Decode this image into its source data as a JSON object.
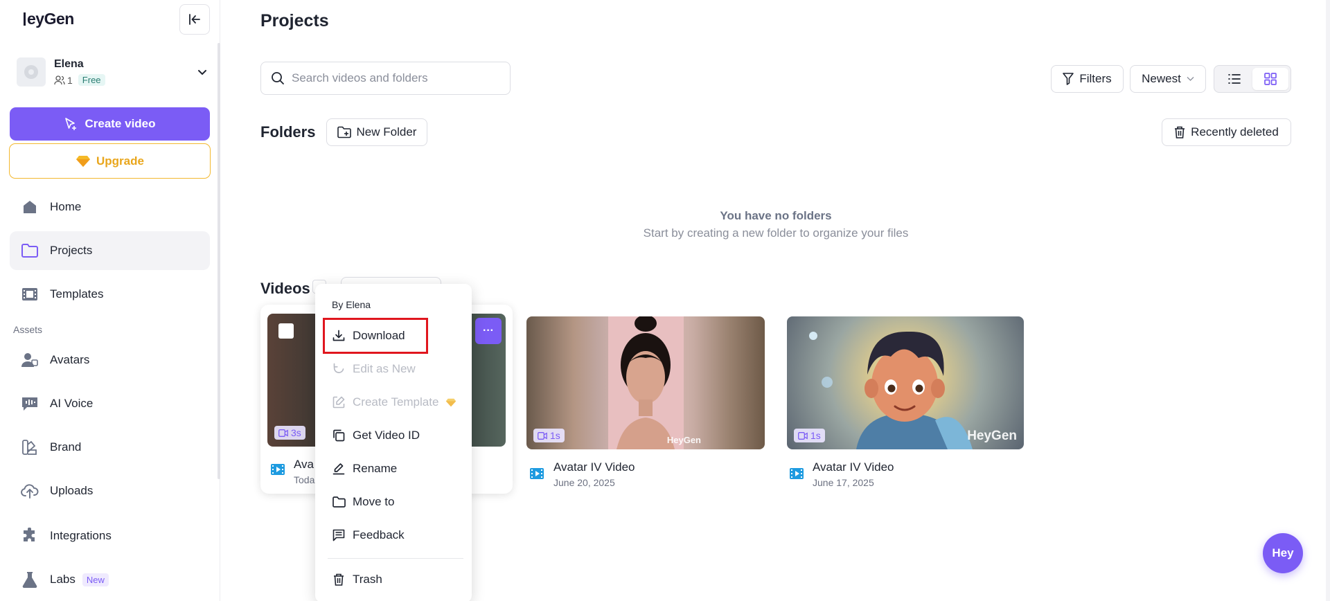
{
  "app": {
    "logo_text": "HeyGen",
    "logo_suffix": "eyGen"
  },
  "sidebar": {
    "user": {
      "name": "Elena",
      "member_count": "1",
      "plan": "Free"
    },
    "create_label": "Create video",
    "upgrade_label": "Upgrade",
    "items": [
      {
        "label": "Home"
      },
      {
        "label": "Projects"
      },
      {
        "label": "Templates"
      },
      {
        "label": "Avatars"
      },
      {
        "label": "AI Voice"
      },
      {
        "label": "Brand"
      },
      {
        "label": "Uploads"
      },
      {
        "label": "Integrations"
      },
      {
        "label": "Labs",
        "badge": "New"
      }
    ],
    "section_assets": "Assets"
  },
  "main": {
    "title": "Projects",
    "search": {
      "placeholder": "Search videos and folders",
      "value": ""
    },
    "filters_label": "Filters",
    "sort_label": "Newest",
    "folders": {
      "title": "Folders",
      "new_folder_label": "New Folder",
      "recently_deleted_label": "Recently deleted",
      "empty_title": "You have no folders",
      "empty_subtitle": "Start by creating a new folder to organize your files"
    },
    "videos": {
      "title": "Videos",
      "items": [
        {
          "title": "Ava",
          "date": "Toda",
          "duration": "3s"
        },
        {
          "title": "Avatar IV Video",
          "date": "June 20, 2025",
          "duration": "1s"
        },
        {
          "title": "Avatar IV Video",
          "date": "June 17, 2025",
          "duration": "1s"
        }
      ]
    }
  },
  "context_menu": {
    "header": "By Elena",
    "items": [
      {
        "label": "Download",
        "enabled": true
      },
      {
        "label": "Edit as New",
        "enabled": false
      },
      {
        "label": "Create Template",
        "enabled": false
      },
      {
        "label": "Get Video ID",
        "enabled": true
      },
      {
        "label": "Rename",
        "enabled": true
      },
      {
        "label": "Move to",
        "enabled": true
      },
      {
        "label": "Feedback",
        "enabled": true
      },
      {
        "label": "Trash",
        "enabled": true
      }
    ]
  },
  "fab_label": "Hey",
  "colors": {
    "accent": "#7b5cf5",
    "upgrade": "#f3b82e",
    "highlight": "#e0161e"
  }
}
